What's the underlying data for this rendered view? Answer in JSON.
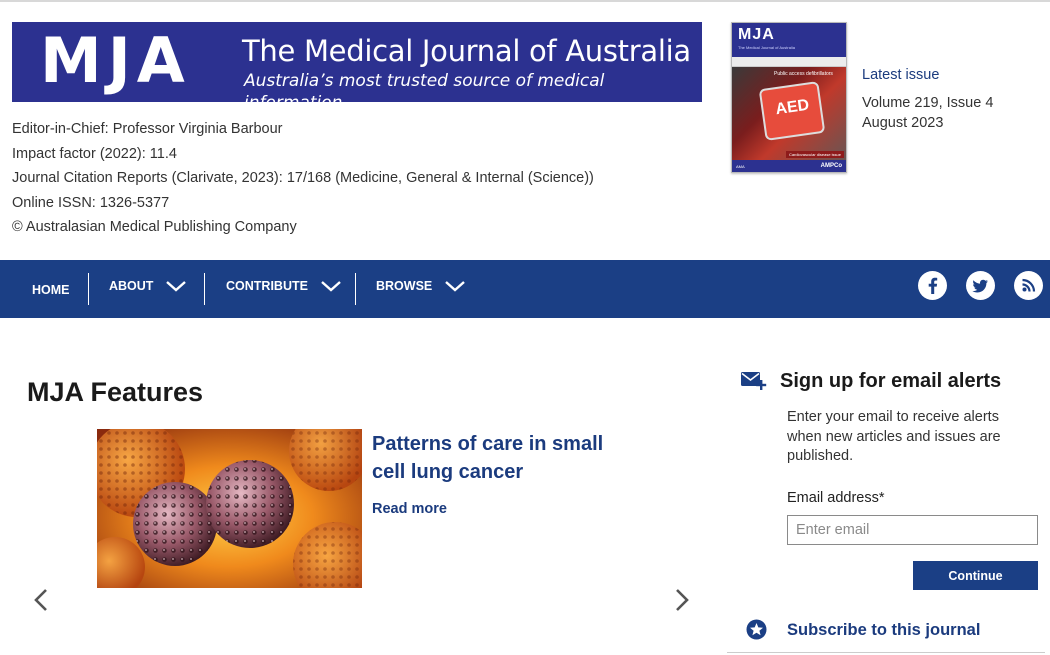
{
  "banner": {
    "logo": "MJA",
    "title": "The Medical Journal of Australia",
    "tagline": "Australia’s most trusted source of medical information"
  },
  "journal_info": {
    "editor": "Editor-in-Chief: Professor Virginia Barbour",
    "impact_factor": "Impact factor (2022): 11.4",
    "citation_reports": "Journal Citation Reports (Clarivate, 2023):  17/168 (Medicine, General & Internal (Science))",
    "issn": "Online ISSN: 1326-5377",
    "copyright": "© Australasian Medical Publishing Company"
  },
  "latest_issue": {
    "label": "Latest issue",
    "volume": "Volume 219, Issue 4",
    "date": "August 2023",
    "cover": {
      "logo": "MJA",
      "subtitle": "The Medical Journal of Australia",
      "caption": "Public access defibrillators",
      "device_text": "AED",
      "badge": "Cardiovascular disease issue",
      "publisher": "AMPCo",
      "footer_small": "AMA"
    }
  },
  "nav": {
    "items": [
      {
        "label": "HOME",
        "has_dropdown": false
      },
      {
        "label": "ABOUT",
        "has_dropdown": true
      },
      {
        "label": "CONTRIBUTE",
        "has_dropdown": true
      },
      {
        "label": "BROWSE",
        "has_dropdown": true
      }
    ],
    "social_icons": [
      "facebook-icon",
      "twitter-icon",
      "rss-icon"
    ]
  },
  "features": {
    "title": "MJA Features",
    "item": {
      "headline": "Patterns of care in small cell lung cancer",
      "read_more": "Read more"
    },
    "prev_icon": "chevron-left-icon",
    "next_icon": "chevron-right-icon"
  },
  "signup": {
    "title": "Sign up for email alerts",
    "description": "Enter your email to receive alerts when new articles and issues are published.",
    "email_label": "Email address*",
    "email_placeholder": "Enter email",
    "email_value": "",
    "continue_label": "Continue",
    "subscribe_label": "Subscribe to this journal"
  },
  "colors": {
    "brand_navy": "#2c3190",
    "nav_blue": "#1b3f85",
    "link_blue": "#1b3b7e"
  }
}
